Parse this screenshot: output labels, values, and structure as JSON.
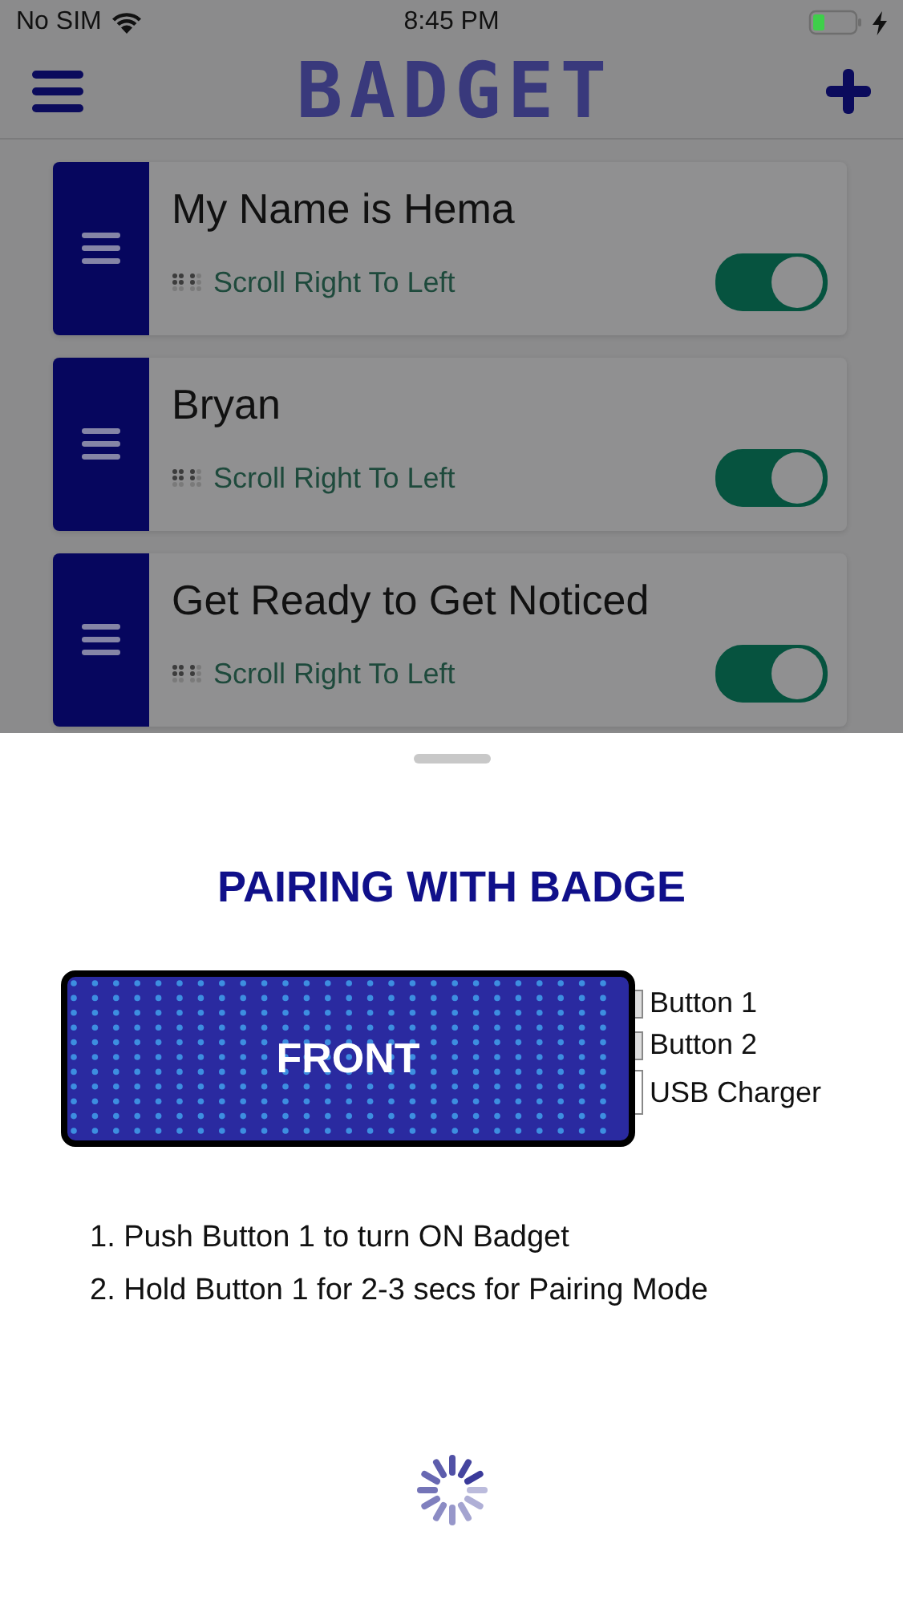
{
  "status_bar": {
    "carrier": "No SIM",
    "time": "8:45 PM"
  },
  "nav": {
    "title": "BADGET"
  },
  "badges": [
    {
      "title": "My Name is Hema",
      "mode": "Scroll Right To Left",
      "on": true
    },
    {
      "title": "Bryan",
      "mode": "Scroll Right To Left",
      "on": true
    },
    {
      "title": "Get Ready to Get Noticed",
      "mode": "Scroll Right To Left",
      "on": true
    }
  ],
  "sheet": {
    "title": "PAIRING WITH BADGE",
    "badge_label": "FRONT",
    "side_labels": [
      "Button 1",
      "Button 2",
      "USB Charger"
    ],
    "steps": [
      "1. Push Button 1 to turn ON Badget",
      "2. Hold Button 1 for 2-3 secs for Pairing Mode"
    ]
  }
}
